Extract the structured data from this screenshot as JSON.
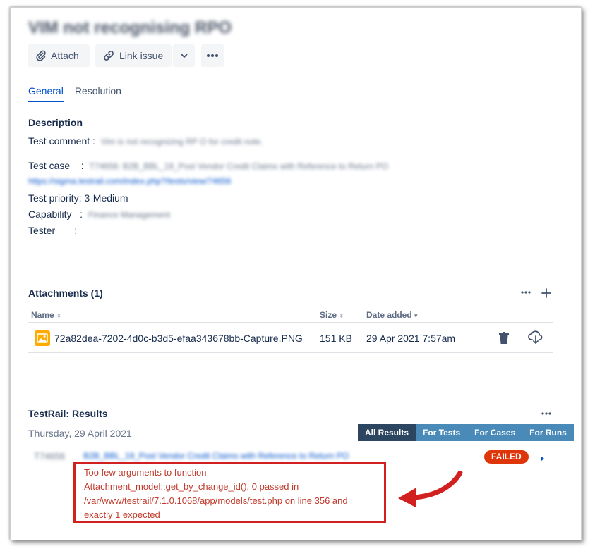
{
  "issue": {
    "title": "VIM not recognising RPO"
  },
  "toolbar": {
    "attach_label": "Attach",
    "link_issue_label": "Link issue"
  },
  "tabs": [
    {
      "label": "General",
      "active": true
    },
    {
      "label": "Resolution",
      "active": false
    }
  ],
  "description": {
    "heading": "Description",
    "test_comment_label": "Test comment :",
    "test_comment_value": "Vim is not recognizing RP O for credit note.",
    "test_case_label": "Test case    :",
    "test_case_value": "T74656: B2B_BBL_19_Post Vendor Credit Claims with Reference to Return PO",
    "test_case_link": "https://sigma.testrail.com/index.php?/tests/view/74656",
    "test_priority": "Test priority: 3-Medium",
    "capability_label": "Capability   :",
    "capability_value": "Finance Management",
    "tester_label": "Tester       :"
  },
  "attachments": {
    "heading": "Attachments (1)",
    "columns": {
      "name": "Name",
      "size": "Size",
      "date": "Date added"
    },
    "rows": [
      {
        "name": "72a82dea-7202-4d0c-b3d5-efaa343678bb-Capture.PNG",
        "size": "151 KB",
        "date": "29 Apr 2021 7:57am"
      }
    ]
  },
  "testrail": {
    "heading": "TestRail: Results",
    "date": "Thursday, 29 April 2021",
    "filters": [
      {
        "label": "All Results",
        "active": true
      },
      {
        "label": "For Tests",
        "active": false
      },
      {
        "label": "For Cases",
        "active": false
      },
      {
        "label": "For Runs",
        "active": false
      }
    ],
    "result": {
      "id": "T74656",
      "title": "B2B_BBL_19_Post Vendor Credit Claims with Reference to Return PO",
      "status": "FAILED",
      "error_lines": [
        "Too few arguments to function",
        "Attachment_model::get_by_change_id(), 0 passed in",
        "/var/www/testrail/7.1.0.1068/app/models/test.php on line 356 and",
        "exactly 1 expected"
      ]
    }
  },
  "colors": {
    "accent": "#0052cc",
    "failed": "#de350b",
    "annotation": "#d21f1f",
    "filter_active": "#2c4560",
    "filter_inactive": "#4a8ab8"
  }
}
